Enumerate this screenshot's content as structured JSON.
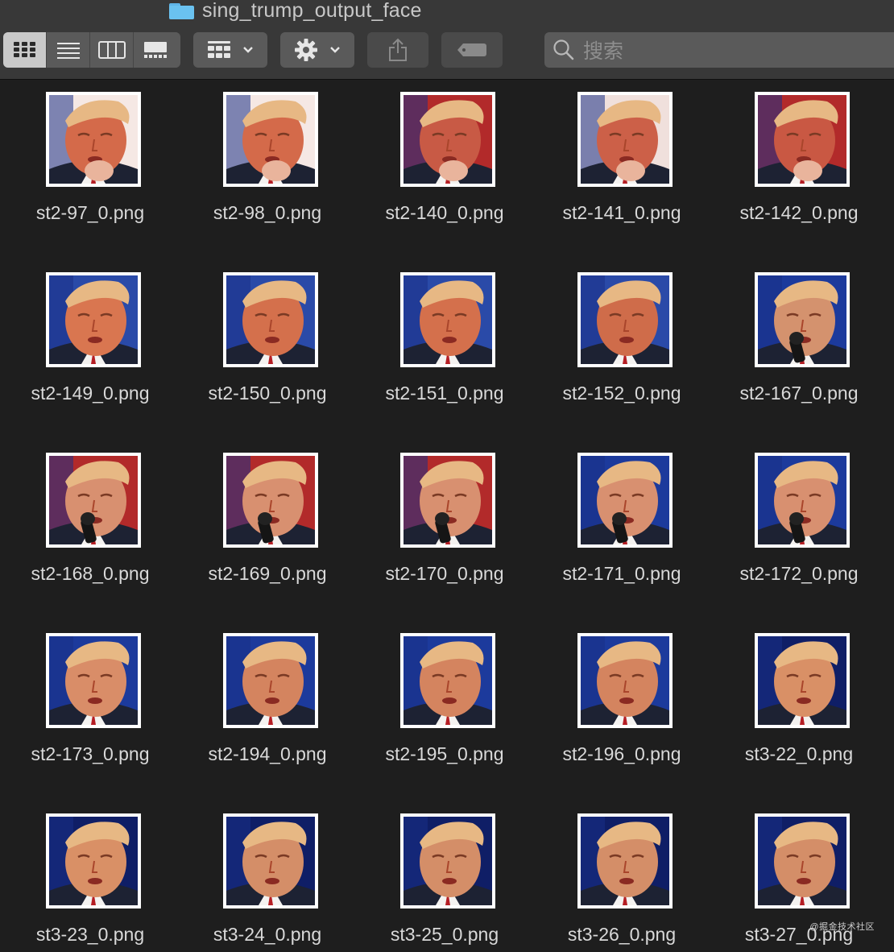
{
  "window": {
    "folder_name": "sing_trump_output_face"
  },
  "toolbar": {
    "view_modes": [
      "icon-view",
      "list-view",
      "column-view",
      "gallery-view"
    ],
    "active_view": "icon-view",
    "group_button_icon": "grid-group-icon",
    "action_button_icon": "gear-icon",
    "share_button_icon": "share-icon",
    "tag_button_icon": "tag-icon",
    "search_placeholder": "搜索"
  },
  "files": [
    {
      "name": "st2-97_0.png",
      "bg": "#d46a4a",
      "accent": "#f5e8e4",
      "mic": false,
      "hand": true
    },
    {
      "name": "st2-98_0.png",
      "bg": "#d46a4a",
      "accent": "#f5e8e4",
      "mic": false,
      "hand": true
    },
    {
      "name": "st2-140_0.png",
      "bg": "#c85a45",
      "accent": "#b22a2a",
      "mic": false,
      "hand": true
    },
    {
      "name": "st2-141_0.png",
      "bg": "#cc6048",
      "accent": "#f0e0dc",
      "mic": false,
      "hand": true
    },
    {
      "name": "st2-142_0.png",
      "bg": "#c95843",
      "accent": "#b22a2a",
      "mic": false,
      "hand": true
    },
    {
      "name": "st2-149_0.png",
      "bg": "#d97650",
      "accent": "#2a4aa8",
      "mic": false,
      "hand": false
    },
    {
      "name": "st2-150_0.png",
      "bg": "#d4704c",
      "accent": "#2a4aa8",
      "mic": false,
      "hand": false
    },
    {
      "name": "st2-151_0.png",
      "bg": "#d4704c",
      "accent": "#2a4aa8",
      "mic": false,
      "hand": false
    },
    {
      "name": "st2-152_0.png",
      "bg": "#cf6c4a",
      "accent": "#2a4aa8",
      "mic": false,
      "hand": false
    },
    {
      "name": "st2-167_0.png",
      "bg": "#d4926e",
      "accent": "#1c3a9c",
      "mic": true,
      "hand": false
    },
    {
      "name": "st2-168_0.png",
      "bg": "#d89070",
      "accent": "#b22a2a",
      "mic": true,
      "hand": false
    },
    {
      "name": "st2-169_0.png",
      "bg": "#d89070",
      "accent": "#b22a2a",
      "mic": true,
      "hand": false
    },
    {
      "name": "st2-170_0.png",
      "bg": "#d89070",
      "accent": "#b22a2a",
      "mic": true,
      "hand": false
    },
    {
      "name": "st2-171_0.png",
      "bg": "#d89070",
      "accent": "#1c3a9c",
      "mic": true,
      "hand": false
    },
    {
      "name": "st2-172_0.png",
      "bg": "#d89070",
      "accent": "#1c3a9c",
      "mic": true,
      "hand": false
    },
    {
      "name": "st2-173_0.png",
      "bg": "#d98d68",
      "accent": "#1c3a9c",
      "mic": false,
      "hand": false
    },
    {
      "name": "st2-194_0.png",
      "bg": "#d4845f",
      "accent": "#1c3a9c",
      "mic": false,
      "hand": false
    },
    {
      "name": "st2-195_0.png",
      "bg": "#d4845f",
      "accent": "#1c3a9c",
      "mic": false,
      "hand": false
    },
    {
      "name": "st2-196_0.png",
      "bg": "#d4845f",
      "accent": "#1c3a9c",
      "mic": false,
      "hand": false
    },
    {
      "name": "st3-22_0.png",
      "bg": "#d99066",
      "accent": "#0f1e66",
      "mic": false,
      "hand": false
    },
    {
      "name": "st3-23_0.png",
      "bg": "#d99066",
      "accent": "#0f1e66",
      "mic": false,
      "hand": false
    },
    {
      "name": "st3-24_0.png",
      "bg": "#d48e68",
      "accent": "#0f1e66",
      "mic": false,
      "hand": false
    },
    {
      "name": "st3-25_0.png",
      "bg": "#d48e68",
      "accent": "#0f1e66",
      "mic": false,
      "hand": false
    },
    {
      "name": "st3-26_0.png",
      "bg": "#d48e68",
      "accent": "#0f1e66",
      "mic": false,
      "hand": false
    },
    {
      "name": "st3-27_0.png",
      "bg": "#d48e68",
      "accent": "#0f1e66",
      "mic": false,
      "hand": false
    }
  ],
  "watermark": "@掘金技术社区"
}
